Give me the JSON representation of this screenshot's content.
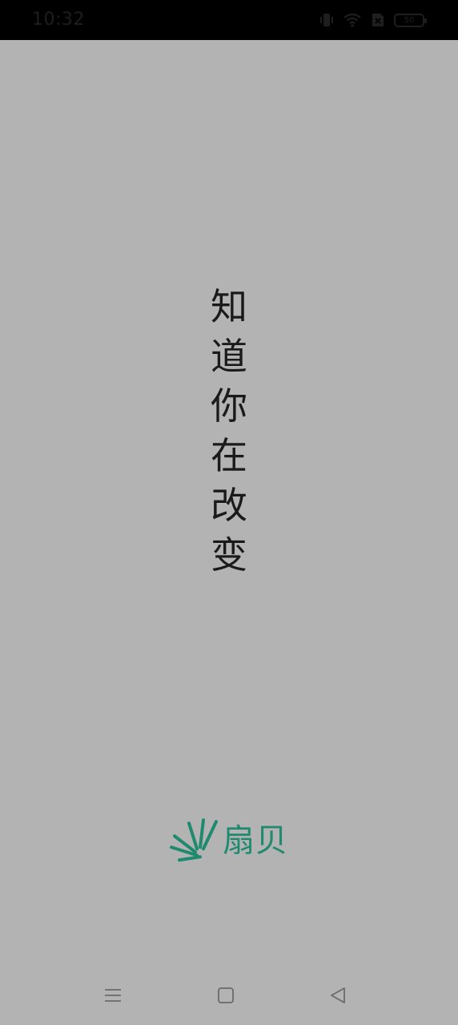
{
  "status_bar": {
    "time": "10:32",
    "battery_level": "50",
    "icons": [
      "vibrate-icon",
      "wifi-icon",
      "no-sim-icon",
      "battery-icon"
    ]
  },
  "slogan": {
    "chars": [
      "知",
      "道",
      "你",
      "在",
      "改",
      "变"
    ]
  },
  "logo": {
    "name": "扇贝",
    "icon": "shanbay-fan-logo-icon"
  },
  "nav_bar": {
    "buttons": [
      "menu-icon",
      "home-icon",
      "back-icon"
    ]
  },
  "colors": {
    "background": "#b3b3b3",
    "status_bar": "#000000",
    "brand_green": "#1f8a6e",
    "text": "#1a1a1a"
  }
}
